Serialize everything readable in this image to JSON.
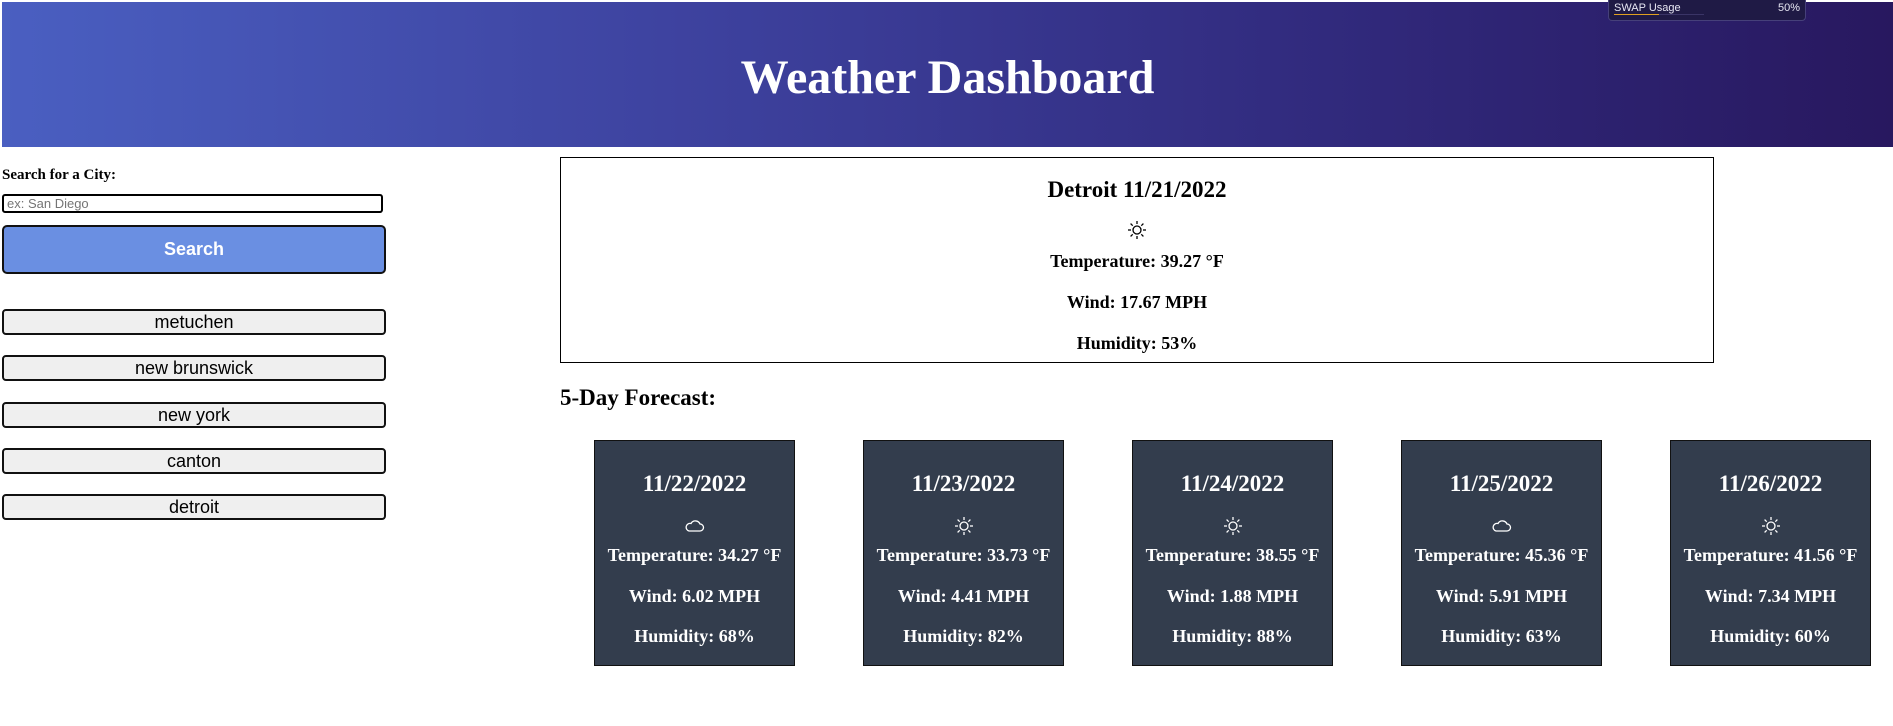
{
  "header": {
    "title": "Weather Dashboard"
  },
  "system_widget": {
    "label": "SWAP Usage",
    "value": "50%",
    "fraction": 0.5
  },
  "search": {
    "label": "Search for a City:",
    "placeholder": "ex: San Diego",
    "value": "",
    "button_label": "Search"
  },
  "history": [
    "metuchen",
    "new brunswick",
    "new york",
    "canton",
    "detroit"
  ],
  "current": {
    "heading": "Detroit 11/21/2022",
    "icon": "sun-icon",
    "temperature": "Temperature: 39.27 °F",
    "wind": "Wind: 17.67 MPH",
    "humidity": "Humidity: 53%"
  },
  "forecast": {
    "title": "5-Day Forecast:",
    "days": [
      {
        "date": "11/22/2022",
        "icon": "cloud-icon",
        "temperature": "Temperature: 34.27 °F",
        "wind": "Wind: 6.02 MPH",
        "humidity": "Humidity: 68%"
      },
      {
        "date": "11/23/2022",
        "icon": "sun-icon",
        "temperature": "Temperature: 33.73 °F",
        "wind": "Wind: 4.41 MPH",
        "humidity": "Humidity: 82%"
      },
      {
        "date": "11/24/2022",
        "icon": "sun-icon",
        "temperature": "Temperature: 38.55 °F",
        "wind": "Wind: 1.88 MPH",
        "humidity": "Humidity: 88%"
      },
      {
        "date": "11/25/2022",
        "icon": "cloud-icon",
        "temperature": "Temperature: 45.36 °F",
        "wind": "Wind: 5.91 MPH",
        "humidity": "Humidity: 63%"
      },
      {
        "date": "11/26/2022",
        "icon": "sun-icon",
        "temperature": "Temperature: 41.56 °F",
        "wind": "Wind: 7.34 MPH",
        "humidity": "Humidity: 60%"
      }
    ]
  },
  "colors": {
    "header_start": "#4a5fc1",
    "header_end": "#28185f",
    "search_button": "#6a8fe2",
    "card_bg": "#333d4d"
  }
}
